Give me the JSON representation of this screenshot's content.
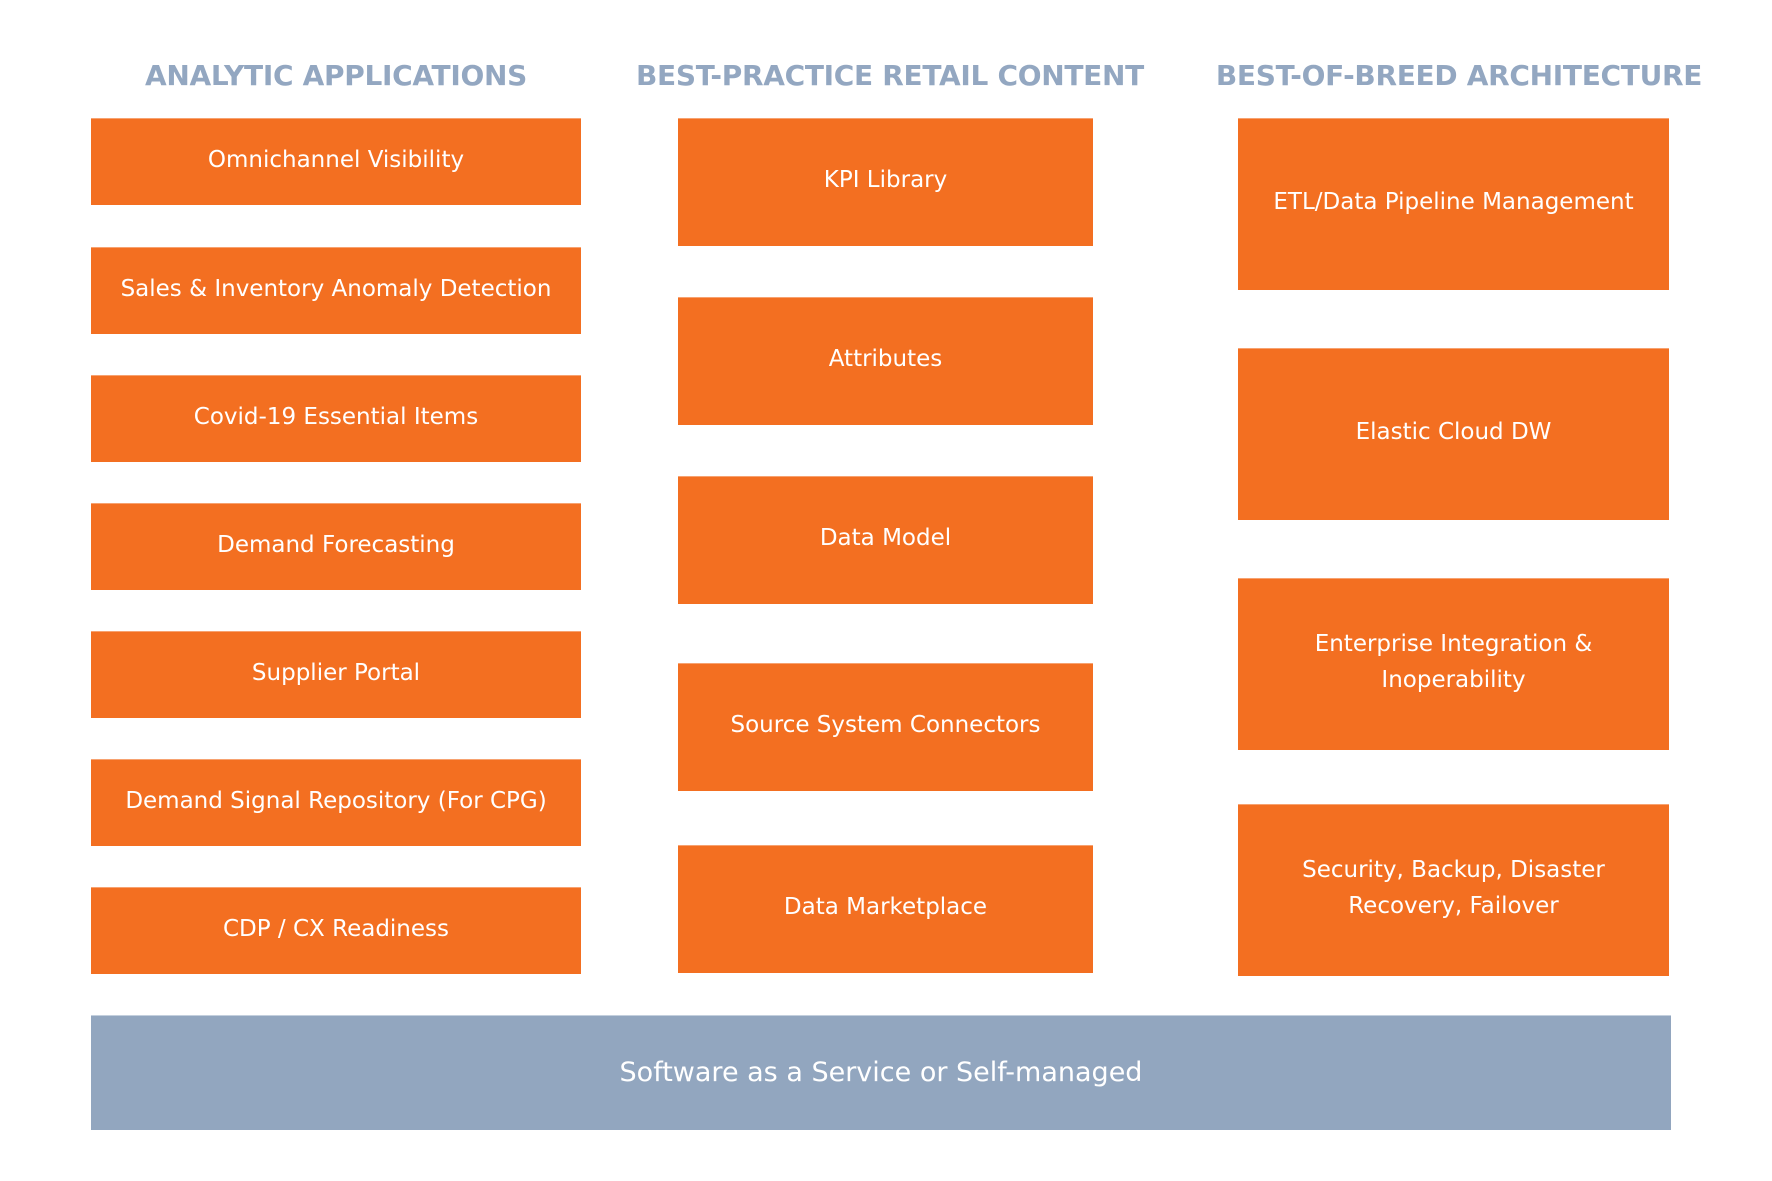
{
  "colors": {
    "box_orange": "#f36f21",
    "heading_blue_gray": "#93a7c1",
    "footer_blue_gray": "#92a6bf",
    "text_white": "#ffffff"
  },
  "columns": [
    {
      "heading": "ANALYTIC APPLICATIONS",
      "items": [
        "Omnichannel Visibility",
        "Sales & Inventory Anomaly Detection",
        "Covid-19 Essential Items",
        "Demand Forecasting",
        "Supplier Portal",
        "Demand Signal Repository (For CPG)",
        "CDP / CX Readiness"
      ]
    },
    {
      "heading": "BEST-PRACTICE RETAIL CONTENT",
      "items": [
        "KPI Library",
        "Attributes",
        "Data Model",
        "Source System Connectors",
        "Data Marketplace"
      ]
    },
    {
      "heading": "BEST-OF-BREED ARCHITECTURE",
      "items": [
        "ETL/Data Pipeline Management",
        "Elastic Cloud DW",
        "Enterprise Integration & Inoperability",
        "Security, Backup, Disaster Recovery, Failover"
      ]
    }
  ],
  "footer": {
    "label": "Software as a Service or Self-managed"
  }
}
